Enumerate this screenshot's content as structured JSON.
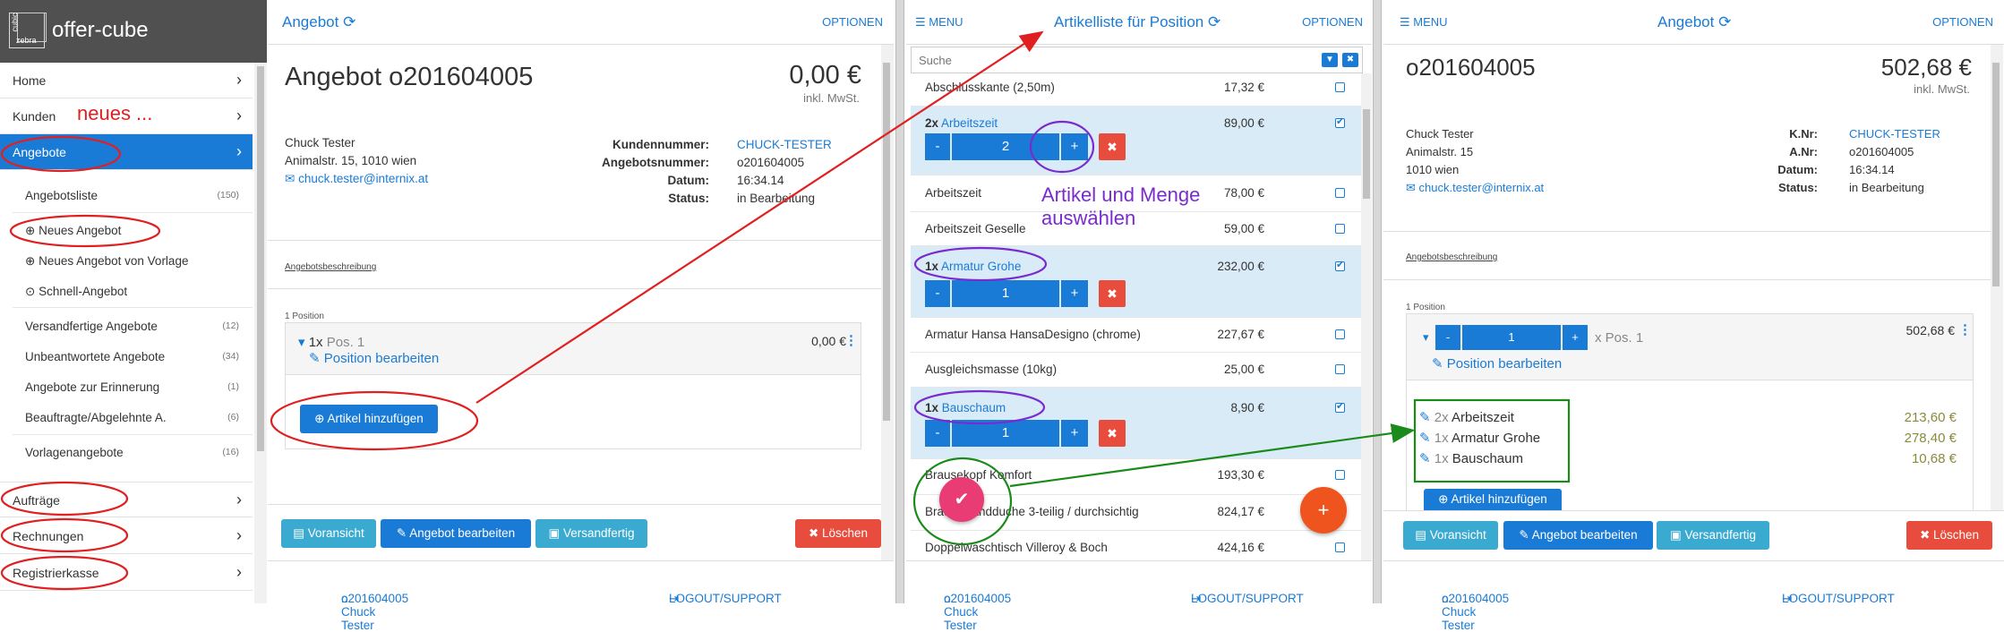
{
  "sidebar": {
    "brand": "offer-cube",
    "logo_top": "cubic",
    "logo_bottom": "zebra",
    "nav": [
      {
        "label": "Home"
      },
      {
        "label": "Kunden"
      },
      {
        "label": "Angebote"
      }
    ],
    "annotation_neues": "neues ...",
    "sub_items": [
      {
        "label": "Angebotsliste",
        "count": "(150)"
      },
      {
        "label": "Neues Angebot",
        "count": ""
      },
      {
        "label": "Neues Angebot von Vorlage",
        "count": ""
      },
      {
        "label": "Schnell-Angebot",
        "count": ""
      },
      {
        "label": "Versandfertige Angebote",
        "count": "(12)"
      },
      {
        "label": "Unbeantwortete Angebote",
        "count": "(34)"
      },
      {
        "label": "Angebote zur Erinnerung",
        "count": "(1)"
      },
      {
        "label": "Beauftragte/Abgelehnte A.",
        "count": "(6)"
      },
      {
        "label": "Vorlagenangebote",
        "count": "(16)"
      }
    ],
    "bottom_nav": [
      {
        "label": "Aufträge"
      },
      {
        "label": "Rechnungen"
      },
      {
        "label": "Registrierkasse"
      }
    ]
  },
  "panel1": {
    "header_title": "Angebot",
    "options": "OPTIONEN",
    "title": "Angebot o201604005",
    "total": "0,00 €",
    "tax_note": "inkl. MwSt.",
    "customer_name": "Chuck Tester",
    "customer_street": "Animalstr. 15, 1010 wien",
    "customer_email": "chuck.tester@internix.at",
    "meta": [
      {
        "key": "Kundennummer:",
        "value": "CHUCK-TESTER"
      },
      {
        "key": "Angebotsnummer:",
        "value": "o201604005"
      },
      {
        "key": "Datum:",
        "value": "16:34.14"
      },
      {
        "key": "Status:",
        "value": "in Bearbeitung"
      }
    ],
    "description_link": "Angebotsbeschreibung",
    "position_count": "1 Position",
    "pos_qty": "1x",
    "pos_label": "Pos. 1",
    "pos_price": "0,00 €",
    "edit_position": "Position bearbeiten",
    "add_article": "Artikel hinzufügen",
    "btn_preview": "Voransicht",
    "btn_edit": "Angebot bearbeiten",
    "btn_ready": "Versandfertig",
    "btn_delete": "Löschen",
    "footer_left": "o201604005 Chuck Tester",
    "footer_right": "LOGOUT/SUPPORT"
  },
  "panel2": {
    "menu": "MENU",
    "header_title": "Artikelliste für Position",
    "options": "OPTIONEN",
    "search_placeholder": "Suche",
    "annotation": "Artikel und Menge auswählen",
    "articles": [
      {
        "qty": "",
        "name": "Abschlusskante (2,50m)",
        "price": "17,32 €",
        "checked": false
      },
      {
        "qty": "2x",
        "name": "Arbeitszeit",
        "price": "89,00 €",
        "checked": true,
        "amount": "2"
      },
      {
        "qty": "",
        "name": "Arbeitszeit",
        "price": "78,00 €",
        "checked": false
      },
      {
        "qty": "",
        "name": "Arbeitszeit Geselle",
        "price": "59,00 €",
        "checked": false
      },
      {
        "qty": "1x",
        "name": "Armatur Grohe",
        "price": "232,00 €",
        "checked": true,
        "amount": "1"
      },
      {
        "qty": "",
        "name": "Armatur Hansa HansaDesigno (chrome)",
        "price": "227,67 €",
        "checked": false
      },
      {
        "qty": "",
        "name": "Ausgleichsmasse (10kg)",
        "price": "25,00 €",
        "checked": false
      },
      {
        "qty": "1x",
        "name": "Bauschaum",
        "price": "8,90 €",
        "checked": true,
        "amount": "1"
      },
      {
        "qty": "",
        "name": "Brausekopf Komfort",
        "price": "193,30 €",
        "checked": false
      },
      {
        "qty": "",
        "name": "Brausewandduche 3-teilig / durchsichtig",
        "price": "824,17 €",
        "checked": false
      },
      {
        "qty": "",
        "name": "Doppelwaschtisch Villeroy & Boch",
        "price": "424,16 €",
        "checked": false
      }
    ],
    "footer_left": "o201604005 Chuck Tester",
    "footer_right": "LOGOUT/SUPPORT"
  },
  "panel3": {
    "menu": "MENU",
    "header_title": "Angebot",
    "options": "OPTIONEN",
    "title": "o201604005",
    "total": "502,68 €",
    "tax_note": "inkl. MwSt.",
    "customer_name": "Chuck Tester",
    "customer_street": "Animalstr. 15",
    "customer_city": "1010 wien",
    "customer_email": "chuck.tester@internix.at",
    "meta": [
      {
        "key": "K.Nr:",
        "value": "CHUCK-TESTER"
      },
      {
        "key": "A.Nr:",
        "value": "o201604005"
      },
      {
        "key": "Datum:",
        "value": "16:34.14"
      },
      {
        "key": "Status:",
        "value": "in Bearbeitung"
      }
    ],
    "description_link": "Angebotsbeschreibung",
    "position_count": "1 Position",
    "pos_amount": "1",
    "pos_label": "x Pos. 1",
    "pos_price": "502,68 €",
    "edit_position": "Position bearbeiten",
    "lines": [
      {
        "qty": "2x",
        "name": "Arbeitszeit",
        "price": "213,60 €"
      },
      {
        "qty": "1x",
        "name": "Armatur Grohe",
        "price": "278,40 €"
      },
      {
        "qty": "1x",
        "name": "Bauschaum",
        "price": "10,68 €"
      }
    ],
    "add_article": "Artikel hinzufügen",
    "btn_preview": "Voransicht",
    "btn_edit": "Angebot bearbeiten",
    "btn_ready": "Versandfertig",
    "btn_delete": "Löschen",
    "footer_left": "o201604005 Chuck Tester",
    "footer_right": "LOGOUT/SUPPORT"
  },
  "colors": {
    "primary": "#1a7bd6",
    "danger": "#e74c3c",
    "info": "#3aaad1",
    "annotation_red": "#e02020",
    "annotation_purple": "#7a2bd0",
    "annotation_green": "#1a8a1a",
    "fab_pink": "#ea3c74",
    "fab_orange": "#f0541e"
  }
}
